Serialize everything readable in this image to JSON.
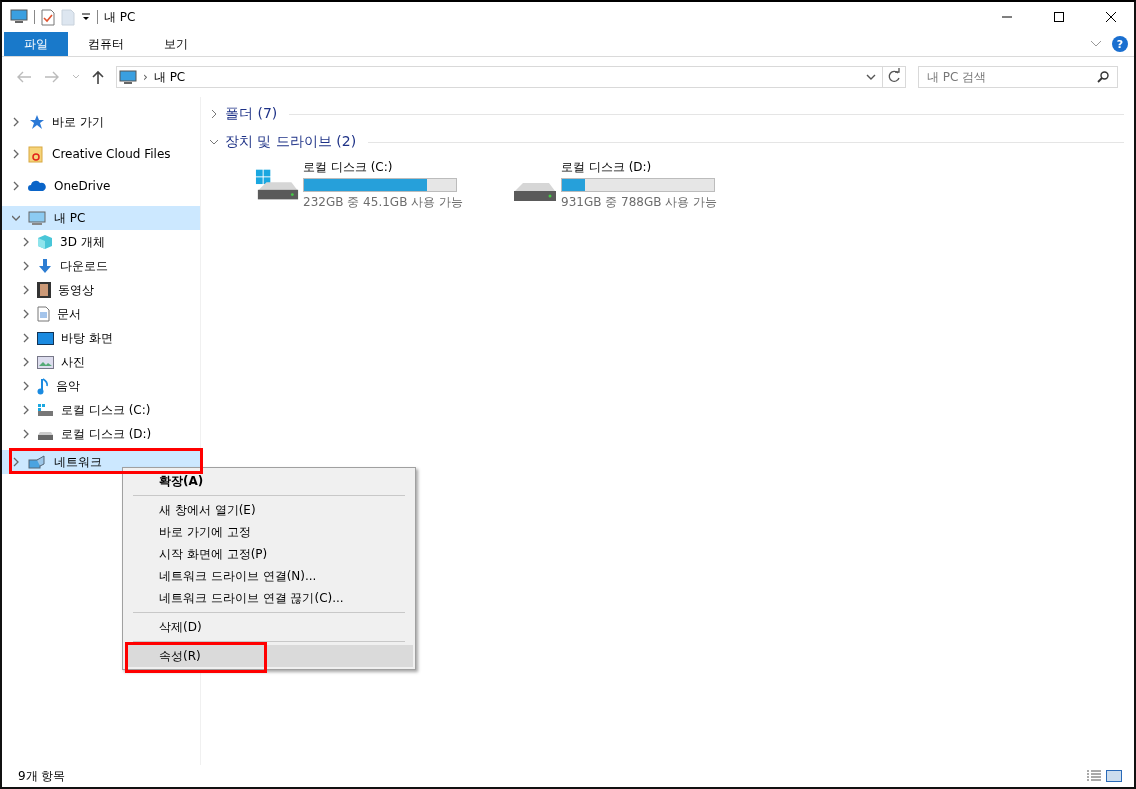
{
  "window": {
    "title": "내 PC"
  },
  "ribbon_tabs": [
    {
      "label": "파일",
      "selected": true
    },
    {
      "label": "컴퓨터",
      "selected": false
    },
    {
      "label": "보기",
      "selected": false
    }
  ],
  "ribbon_help": "?",
  "address": {
    "path": "내 PC",
    "separator": "›"
  },
  "search": {
    "placeholder": "내 PC 검색"
  },
  "sidebar": {
    "items": [
      {
        "label": "바로 가기",
        "expanded": false,
        "selected": false
      },
      {
        "label": "Creative Cloud Files",
        "expanded": false,
        "selected": false
      },
      {
        "label": "OneDrive",
        "expanded": false,
        "selected": false
      },
      {
        "label": "내 PC",
        "expanded": true,
        "selected": true,
        "children": [
          {
            "label": "3D 개체"
          },
          {
            "label": "다운로드"
          },
          {
            "label": "동영상"
          },
          {
            "label": "문서"
          },
          {
            "label": "바탕 화면"
          },
          {
            "label": "사진"
          },
          {
            "label": "음악"
          },
          {
            "label": "로컬 디스크 (C:)"
          },
          {
            "label": "로컬 디스크 (D:)"
          }
        ]
      },
      {
        "label": "네트워크",
        "expanded": false,
        "selected": true
      }
    ]
  },
  "groups": [
    {
      "title": "폴더",
      "count": "(7)",
      "expanded": false
    },
    {
      "title": "장치 및 드라이브",
      "count": "(2)",
      "expanded": true
    }
  ],
  "drives": [
    {
      "name": "로컬 디스크 (C:)",
      "level": 0.81,
      "reading": "232GB 중 45.1GB 사용 가능"
    },
    {
      "name": "로컬 디스크 (D:)",
      "level": 0.15,
      "reading": "931GB 중 788GB 사용 가능"
    }
  ],
  "context_menu": {
    "items": [
      {
        "kind": "item",
        "label": "확장(A)",
        "default": true,
        "selected": false
      },
      {
        "kind": "separator"
      },
      {
        "kind": "item",
        "label": "새 창에서 열기(E)",
        "default": false,
        "selected": false
      },
      {
        "kind": "item",
        "label": "바로 가기에 고정",
        "default": false,
        "selected": false
      },
      {
        "kind": "item",
        "label": "시작 화면에 고정(P)",
        "default": false,
        "selected": false
      },
      {
        "kind": "item",
        "label": "네트워크 드라이브 연결(N)...",
        "default": false,
        "selected": false
      },
      {
        "kind": "item",
        "label": "네트워크 드라이브 연결 끊기(C)...",
        "default": false,
        "selected": false
      },
      {
        "kind": "separator"
      },
      {
        "kind": "item",
        "label": "삭제(D)",
        "default": false,
        "selected": false
      },
      {
        "kind": "separator"
      },
      {
        "kind": "item",
        "label": "속성(R)",
        "default": false,
        "selected": true
      }
    ]
  },
  "status_bar": {
    "count": "9개 항목"
  }
}
